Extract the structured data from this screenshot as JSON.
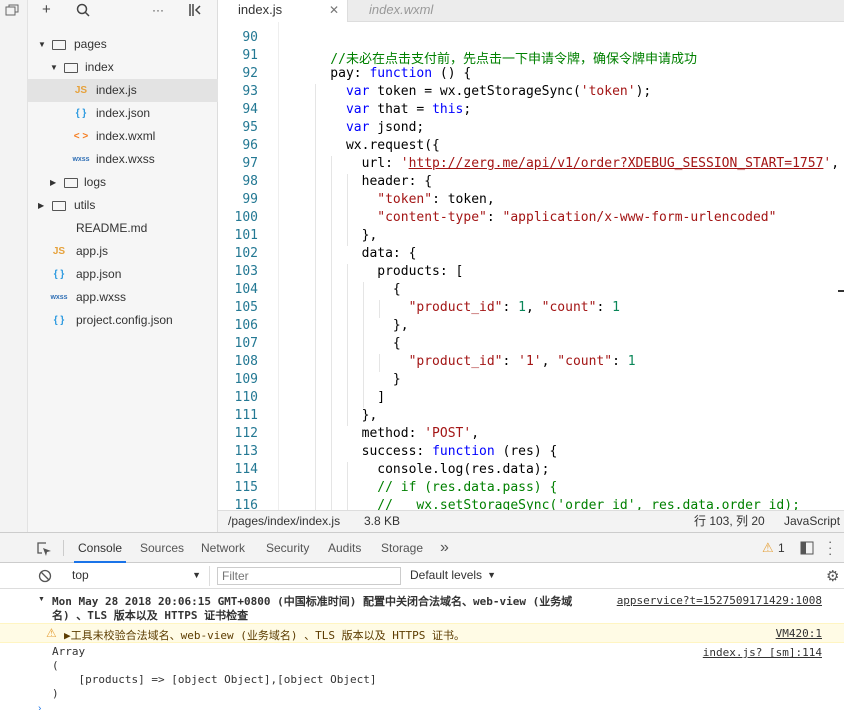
{
  "explorer": {
    "tree": [
      {
        "label": "pages",
        "kind": "folder",
        "expanded": true
      },
      {
        "label": "index",
        "kind": "folder",
        "expanded": true
      },
      {
        "label": "index.js",
        "kind": "js",
        "icon": "JS",
        "active": true
      },
      {
        "label": "index.json",
        "kind": "json",
        "icon": "{ }"
      },
      {
        "label": "index.wxml",
        "kind": "wxml",
        "icon": "< >"
      },
      {
        "label": "index.wxss",
        "kind": "wxss",
        "icon": "wxss"
      },
      {
        "label": "logs",
        "kind": "folder",
        "expanded": false
      },
      {
        "label": "utils",
        "kind": "folder",
        "expanded": false
      },
      {
        "label": "README.md",
        "kind": "md",
        "icon": ""
      },
      {
        "label": "app.js",
        "kind": "js",
        "icon": "JS"
      },
      {
        "label": "app.json",
        "kind": "json",
        "icon": "{ }"
      },
      {
        "label": "app.wxss",
        "kind": "wxss",
        "icon": "wxss"
      },
      {
        "label": "project.config.json",
        "kind": "json",
        "icon": "{ }"
      }
    ]
  },
  "editor_tabs": [
    {
      "label": "index.js",
      "active": true
    },
    {
      "label": "index.wxml",
      "active": false
    }
  ],
  "editor": {
    "line_numbers": [
      "90",
      "91",
      "92",
      "93",
      "94",
      "95",
      "96",
      "97",
      "98",
      "99",
      "100",
      "101",
      "102",
      "103",
      "104",
      "105",
      "106",
      "107",
      "108",
      "109",
      "110",
      "111",
      "112",
      "113",
      "114",
      "115",
      "116"
    ],
    "lines": [
      [],
      [
        {
          "t": "    //未必在点击支付前，先点击一下申请令牌，确保令牌申请成功",
          "c": "cmt"
        }
      ],
      [
        {
          "t": "    pay: ",
          "c": ""
        },
        {
          "t": "function",
          "c": "kw"
        },
        {
          "t": " () {",
          "c": ""
        }
      ],
      [
        {
          "t": "      ",
          "c": ""
        },
        {
          "t": "var",
          "c": "kw"
        },
        {
          "t": " token = wx.getStorageSync(",
          "c": ""
        },
        {
          "t": "'token'",
          "c": "str"
        },
        {
          "t": ");",
          "c": ""
        }
      ],
      [
        {
          "t": "      ",
          "c": ""
        },
        {
          "t": "var",
          "c": "kw"
        },
        {
          "t": " that = ",
          "c": ""
        },
        {
          "t": "this",
          "c": "kw"
        },
        {
          "t": ";",
          "c": ""
        }
      ],
      [
        {
          "t": "      ",
          "c": ""
        },
        {
          "t": "var",
          "c": "kw"
        },
        {
          "t": " jsond;",
          "c": ""
        }
      ],
      [
        {
          "t": "      wx.request({",
          "c": ""
        }
      ],
      [
        {
          "t": "        url: ",
          "c": ""
        },
        {
          "t": "'",
          "c": "str"
        },
        {
          "t": "http://zerg.me/api/v1/order?XDEBUG_SESSION_START=1757",
          "c": "url"
        },
        {
          "t": "'",
          "c": "str"
        },
        {
          "t": ",",
          "c": ""
        }
      ],
      [
        {
          "t": "        header: {",
          "c": ""
        }
      ],
      [
        {
          "t": "          ",
          "c": ""
        },
        {
          "t": "\"token\"",
          "c": "str"
        },
        {
          "t": ": token,",
          "c": ""
        }
      ],
      [
        {
          "t": "          ",
          "c": ""
        },
        {
          "t": "\"content-type\"",
          "c": "str"
        },
        {
          "t": ": ",
          "c": ""
        },
        {
          "t": "\"application/x-www-form-urlencoded\"",
          "c": "str"
        }
      ],
      [
        {
          "t": "        },",
          "c": ""
        }
      ],
      [
        {
          "t": "        data: {",
          "c": ""
        }
      ],
      [
        {
          "t": "          products: [",
          "c": ""
        }
      ],
      [
        {
          "t": "            {",
          "c": ""
        }
      ],
      [
        {
          "t": "              ",
          "c": ""
        },
        {
          "t": "\"product_id\"",
          "c": "str"
        },
        {
          "t": ": ",
          "c": ""
        },
        {
          "t": "1",
          "c": "num"
        },
        {
          "t": ", ",
          "c": ""
        },
        {
          "t": "\"count\"",
          "c": "str"
        },
        {
          "t": ": ",
          "c": ""
        },
        {
          "t": "1",
          "c": "num"
        }
      ],
      [
        {
          "t": "            },",
          "c": ""
        }
      ],
      [
        {
          "t": "            {",
          "c": ""
        }
      ],
      [
        {
          "t": "              ",
          "c": ""
        },
        {
          "t": "\"product_id\"",
          "c": "str"
        },
        {
          "t": ": ",
          "c": ""
        },
        {
          "t": "'1'",
          "c": "str"
        },
        {
          "t": ", ",
          "c": ""
        },
        {
          "t": "\"count\"",
          "c": "str"
        },
        {
          "t": ": ",
          "c": ""
        },
        {
          "t": "1",
          "c": "num"
        }
      ],
      [
        {
          "t": "            }",
          "c": ""
        }
      ],
      [
        {
          "t": "          ]",
          "c": ""
        }
      ],
      [
        {
          "t": "        },",
          "c": ""
        }
      ],
      [
        {
          "t": "        method: ",
          "c": ""
        },
        {
          "t": "'POST'",
          "c": "str"
        },
        {
          "t": ",",
          "c": ""
        }
      ],
      [
        {
          "t": "        success: ",
          "c": ""
        },
        {
          "t": "function",
          "c": "kw"
        },
        {
          "t": " (res) {",
          "c": ""
        }
      ],
      [
        {
          "t": "          console.log(res.data);",
          "c": ""
        }
      ],
      [
        {
          "t": "          // if (res.data.pass) {",
          "c": "cmt"
        }
      ],
      [
        {
          "t": "          //   wx.setStorageSync('order_id', res.data.order_id);",
          "c": "cmt"
        }
      ]
    ]
  },
  "statusbar": {
    "path": "/pages/index/index.js",
    "size": "3.8 KB",
    "position": "行 103, 列 20",
    "language": "JavaScript"
  },
  "devtools": {
    "tabs": [
      "Console",
      "Sources",
      "Network",
      "Security",
      "Audits",
      "Storage"
    ],
    "more": "»",
    "warn_badge": "1",
    "context": "top",
    "filter_placeholder": "Filter",
    "levels": "Default levels",
    "messages": {
      "info_line1": "Mon May 28 2018 20:06:15 GMT+0800 (中国标准时间) 配置中关闭合法域名、web-view (业务域",
      "info_line2": "名) 、TLS 版本以及 HTTPS 证书检查",
      "info_src": "appservice?t=1527509171429:1008",
      "warn_text": "▶工具未校验合法域名、web-view (业务域名) 、TLS 版本以及 HTTPS 证书。",
      "warn_src": "VM420:1",
      "log_lines": [
        "Array",
        "(",
        "    [products] => [object Object],[object Object]",
        ")"
      ],
      "log_src": "index.js? [sm]:114"
    }
  }
}
